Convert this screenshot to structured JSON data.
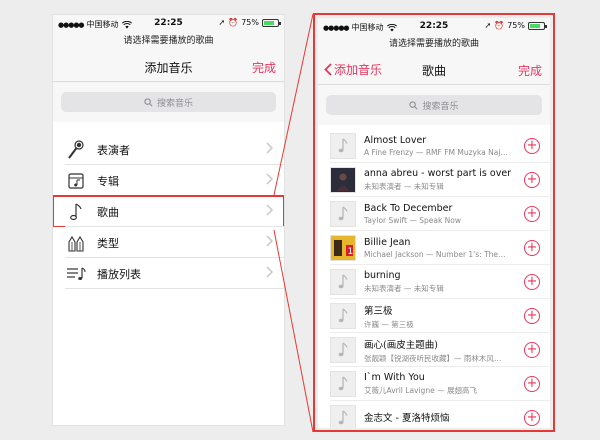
{
  "status": {
    "carrier": "中国移动",
    "time": "22:25",
    "battery": "75%",
    "battery_level": 0.75
  },
  "colors": {
    "accent": "#e8365d",
    "highlight": "#e53935"
  },
  "left": {
    "prompt": "请选择需要播放的歌曲",
    "title": "添加音乐",
    "done": "完成",
    "search_placeholder": "搜索音乐",
    "menu": [
      {
        "label": "表演者",
        "icon": "microphone-icon"
      },
      {
        "label": "专辑",
        "icon": "album-icon"
      },
      {
        "label": "歌曲",
        "icon": "music-note-icon"
      },
      {
        "label": "类型",
        "icon": "guitar-icon"
      },
      {
        "label": "播放列表",
        "icon": "playlist-icon"
      }
    ]
  },
  "right": {
    "prompt": "请选择需要播放的歌曲",
    "back": "添加音乐",
    "title": "歌曲",
    "done": "完成",
    "search_placeholder": "搜索音乐",
    "songs": [
      {
        "title": "Almost Lover",
        "subtitle": "A Fine Frenzy — RMF FM Muzyka Naj…",
        "art": "placeholder"
      },
      {
        "title": "anna abreu - worst part is over",
        "subtitle": "未知表演者 — 未知专辑",
        "art": "dark"
      },
      {
        "title": "Back To December",
        "subtitle": "Taylor Swift — Speak Now",
        "art": "placeholder"
      },
      {
        "title": "Billie Jean",
        "subtitle": "Michael Jackson — Number 1's: The…",
        "art": "yellow"
      },
      {
        "title": "burning",
        "subtitle": "未知表演者 — 未知专辑",
        "art": "placeholder"
      },
      {
        "title": "第三极",
        "subtitle": "许巍 — 第三极",
        "art": "placeholder"
      },
      {
        "title": "画心(画皮主题曲)",
        "subtitle": "张靓颖【锐湖夜听民收藏】— 雨林木风…",
        "art": "placeholder"
      },
      {
        "title": "I`m With You",
        "subtitle": "艾薇儿Avril Lavigne — 展翅高飞",
        "art": "placeholder"
      },
      {
        "title": "金志文 - 夏洛特烦恼",
        "subtitle": "",
        "art": "placeholder"
      }
    ]
  }
}
